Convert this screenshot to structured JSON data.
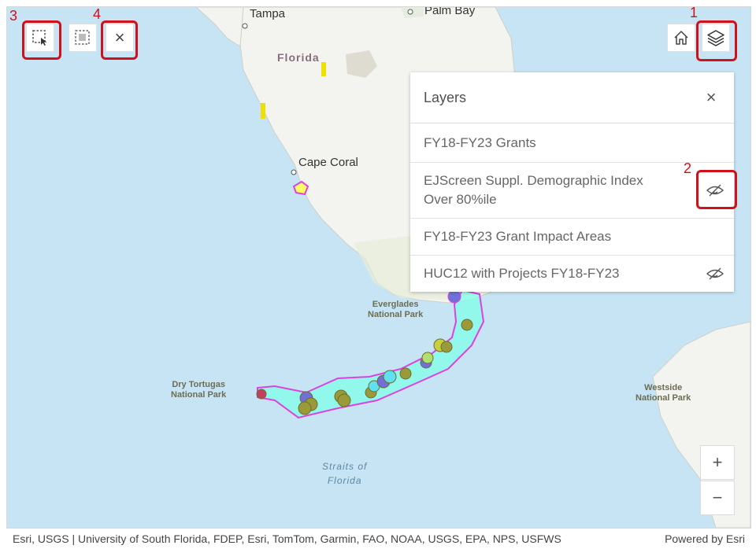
{
  "map": {
    "places": {
      "tampa": "Tampa",
      "palm_bay": "Palm Bay",
      "florida": "Florida",
      "cape_coral": "Cape Coral",
      "everglades": "Everglades\nNational Park",
      "dry_tortugas": "Dry Tortugas\nNational Park",
      "westside": "Westside\nNational Park",
      "straits": "Straits of\nFlorida"
    }
  },
  "toolbar": {
    "select_icon": "select-rectangle-icon",
    "select_by_layer_icon": "select-by-layer-icon",
    "clear_label": "×",
    "home_icon": "home-icon",
    "layers_icon": "layers-icon"
  },
  "callouts": {
    "c1": "1",
    "c2": "2",
    "c3": "3",
    "c4": "4"
  },
  "layers_panel": {
    "title": "Layers",
    "close_label": "×",
    "items": [
      {
        "label": "FY18-FY23 Grants",
        "hidden": false
      },
      {
        "label": "EJScreen Suppl. Demographic Index Over 80%ile",
        "hidden": true
      },
      {
        "label": "FY18-FY23 Grant Impact Areas",
        "hidden": false
      },
      {
        "label": "HUC12 with Projects FY18-FY23",
        "hidden": true
      }
    ]
  },
  "zoom": {
    "in_label": "+",
    "out_label": "−"
  },
  "attribution": {
    "sources": "Esri, USGS | University of South Florida, FDEP, Esri, TomTom, Garmin, FAO, NOAA, USGS, EPA, NPS, USFWS",
    "powered_by": "Powered by Esri"
  },
  "colors": {
    "highlight": "#d0111b",
    "water": "#c6e4f3",
    "land": "#f2f2ee",
    "impact_area": "#7fffe8",
    "impact_outline": "#e040e0",
    "grant_point": "#9a9a3a"
  }
}
